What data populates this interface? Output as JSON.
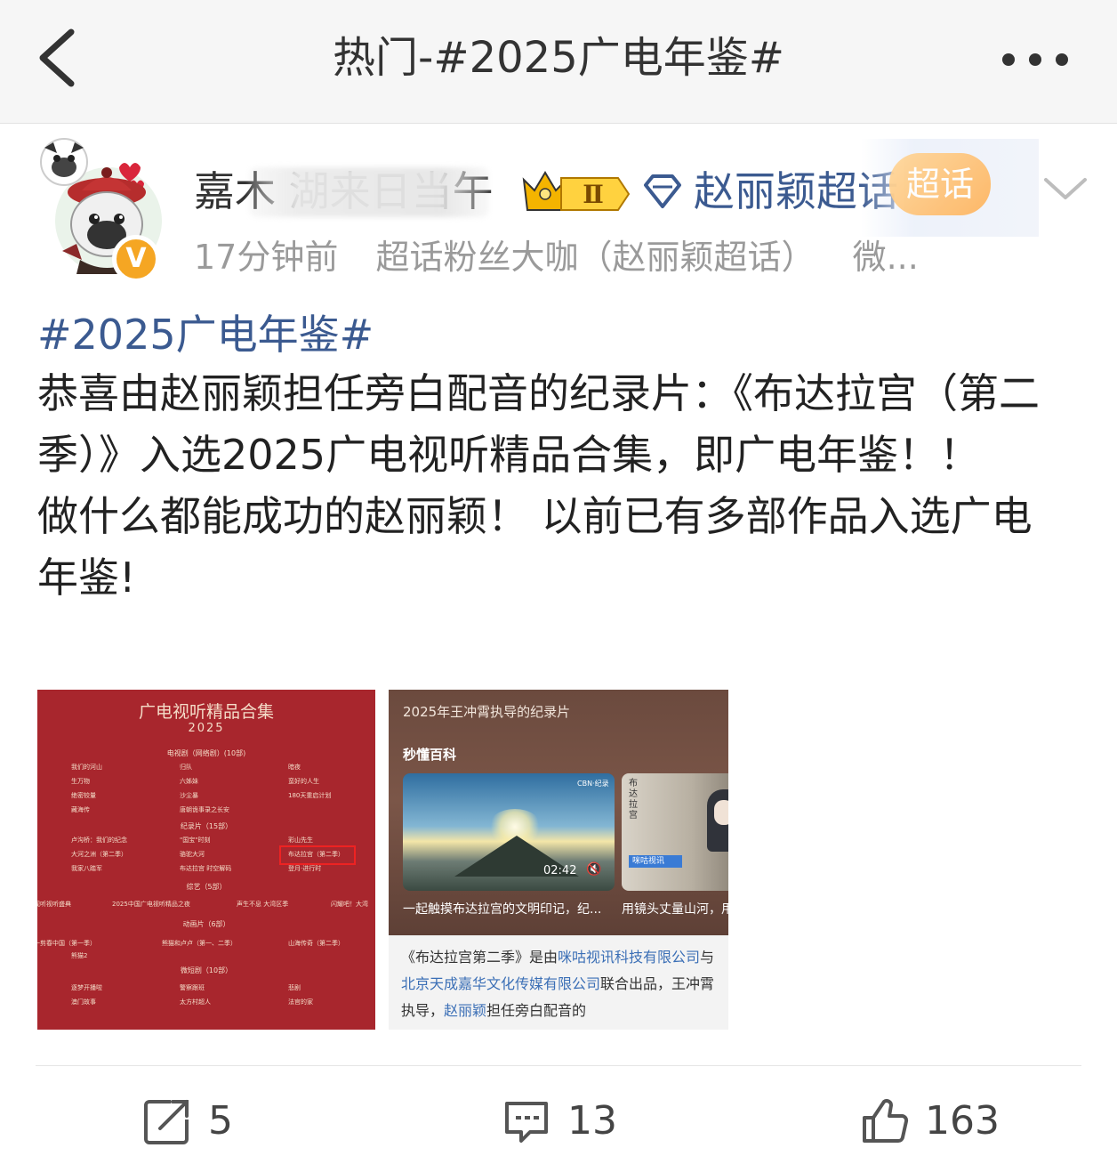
{
  "nav": {
    "title": "热门-#2025广电年鉴#",
    "back_icon": "chevron-left-icon",
    "more_icon": "more-dots-icon"
  },
  "author": {
    "username": "嘉木 湖来日当午",
    "level_badge": "Ⅱ",
    "supertopic": "赵丽颖超话",
    "supertopic_tag": "超话",
    "verified_mark": "V",
    "time": "17分钟前",
    "source": "超话粉丝大咖（赵丽颖超话）",
    "client": "微..."
  },
  "post": {
    "hashtag": "#2025广电年鉴#",
    "paragraphs": [
      "恭喜由赵丽颖担任旁白配音的纪录片：《布达拉宫（第二季）》入选2025广电视听精品合集，即广电年鉴！！",
      "做什么都能成功的赵丽颖！ 以前已有多部作品入选广电年鉴!"
    ]
  },
  "image1": {
    "title": "广电视听精品合集",
    "year": "2025",
    "sections": [
      "电视剧（网络剧）(10部)",
      "纪录片（15部）",
      "综艺（5部）",
      "动画片（6部）",
      "微短剧（10部）"
    ],
    "rows_tv": [
      [
        "我们的河山",
        "归队",
        "暗夜"
      ],
      [
        "生万物",
        "六姊妹",
        "蛮好的人生"
      ],
      [
        "绝密较量",
        "沙尘暴",
        "180天重启计划"
      ],
      [
        "藏海传",
        "唐朝诡事录之长安",
        ""
      ]
    ],
    "rows_doc": [
      [
        "卢沟桥：我们的纪念",
        "\"国宝\"时刻",
        "彩山先生"
      ],
      [
        "大河之洲（第二季）",
        "骆驼大河",
        "布达拉宫（第二季）"
      ],
      [
        "我家八踏军",
        "布达拉宫 时空解码",
        "登月·进行时"
      ]
    ],
    "rows_var": [
      [
        "视听视听盛典",
        "2025中国广电视听精品之夜",
        "声生不息 大湾区季",
        "闪耀吧！大湾"
      ]
    ],
    "rows_ani": [
      [
        "一剪春中国（第一季）",
        "熊猫和卢卢（第一、二季）",
        "山海传奇（第二季）"
      ],
      [
        "熊猫2",
        "",
        ""
      ]
    ],
    "rows_short": [
      [
        "逐梦开播啦",
        "警察跟班",
        "悲剧"
      ],
      [
        "澳门故事",
        "太方村超人",
        "法官的家"
      ]
    ]
  },
  "image2": {
    "subtitle": "2025年王冲霄执导的纪录片",
    "kicker": "秒懂百科",
    "video1_duration": "02:42",
    "video1_tag": "CBN·纪录",
    "video2_title": "布达拉宫",
    "video2_logo": "咪咕视讯",
    "caption1": "一起触摸布达拉宫的文明印记，纪...",
    "caption2": "用镜头丈量山河，用",
    "desc_1": "《布达拉宫第二季》是由",
    "desc_link1": "咪咕视讯科技有限公司",
    "desc_2": "与",
    "desc_link2": "北京天成嘉华文化传媒有限公司",
    "desc_3": "联合出品，王冲霄执导，",
    "desc_link3": "赵丽颖",
    "desc_4": "担任旁白配音的"
  },
  "actions": {
    "repost_icon": "repost-icon",
    "comment_icon": "comment-icon",
    "like_icon": "like-icon",
    "repost_count": "5",
    "comment_count": "13",
    "like_count": "163"
  },
  "colors": {
    "link": "#3b5a90",
    "nav_bg": "#f6f6f6",
    "poster_red": "#a8262d"
  }
}
